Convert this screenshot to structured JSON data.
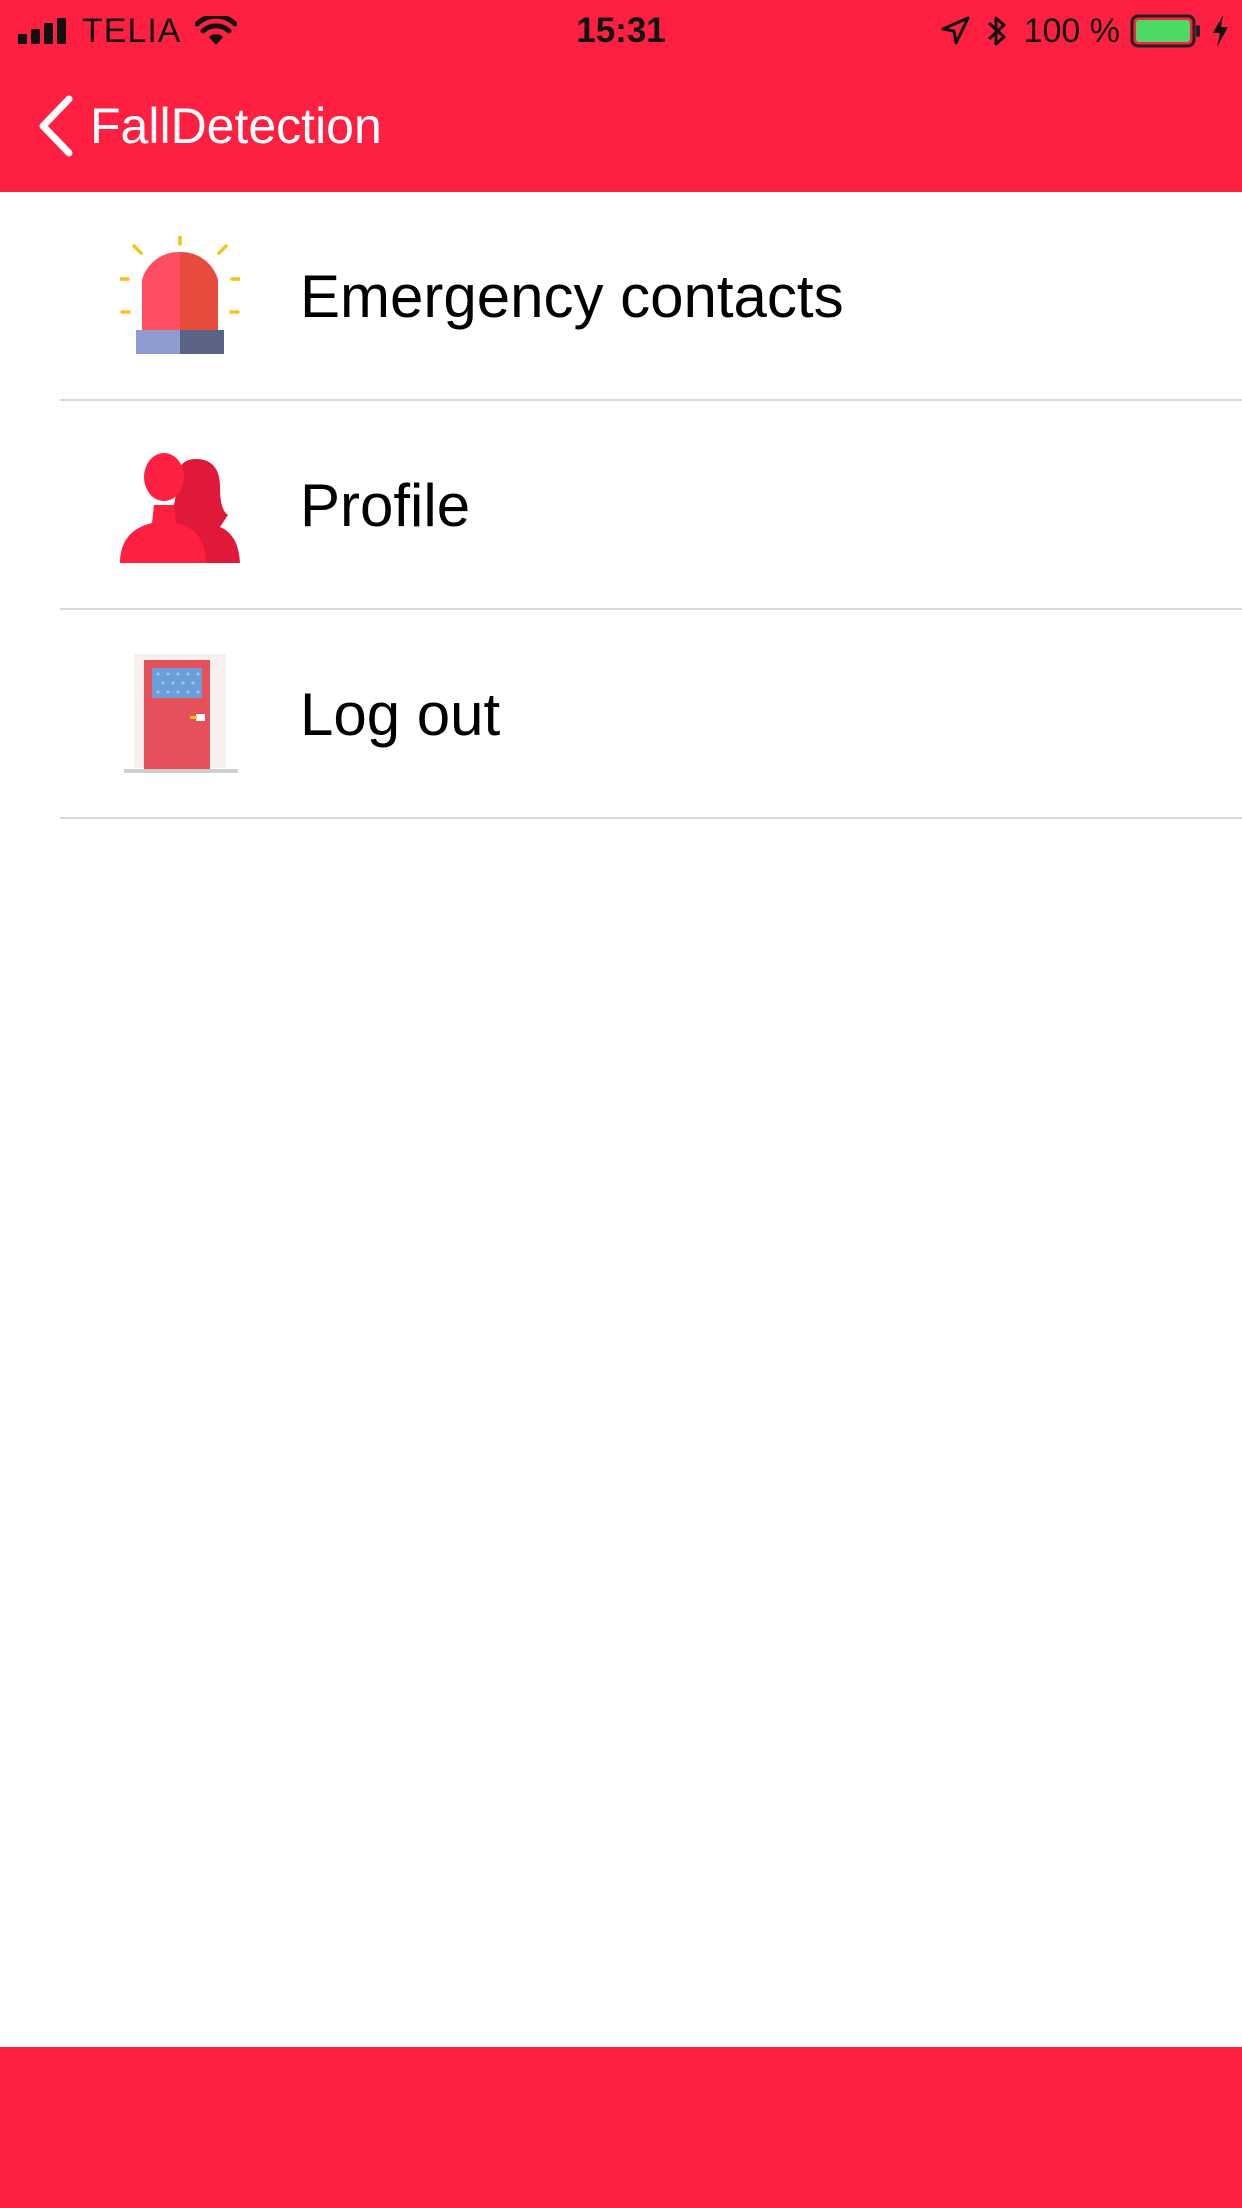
{
  "theme": {
    "accent": "#ff1f40",
    "divider": "#d9d9d9",
    "background": "#ffffff"
  },
  "status_bar": {
    "carrier": "TELIA",
    "time": "15:31",
    "battery": "100 %",
    "icons": [
      "signal-icon",
      "wifi-icon",
      "location-arrow-icon",
      "bluetooth-icon",
      "battery-icon",
      "charging-bolt-icon"
    ]
  },
  "nav": {
    "back_label": "FallDetection",
    "back_icon": "chevron-left-icon"
  },
  "menu": {
    "items": [
      {
        "label": "Emergency contacts",
        "icon": "siren-icon"
      },
      {
        "label": "Profile",
        "icon": "users-icon"
      },
      {
        "label": "Log out",
        "icon": "door-icon"
      }
    ]
  }
}
